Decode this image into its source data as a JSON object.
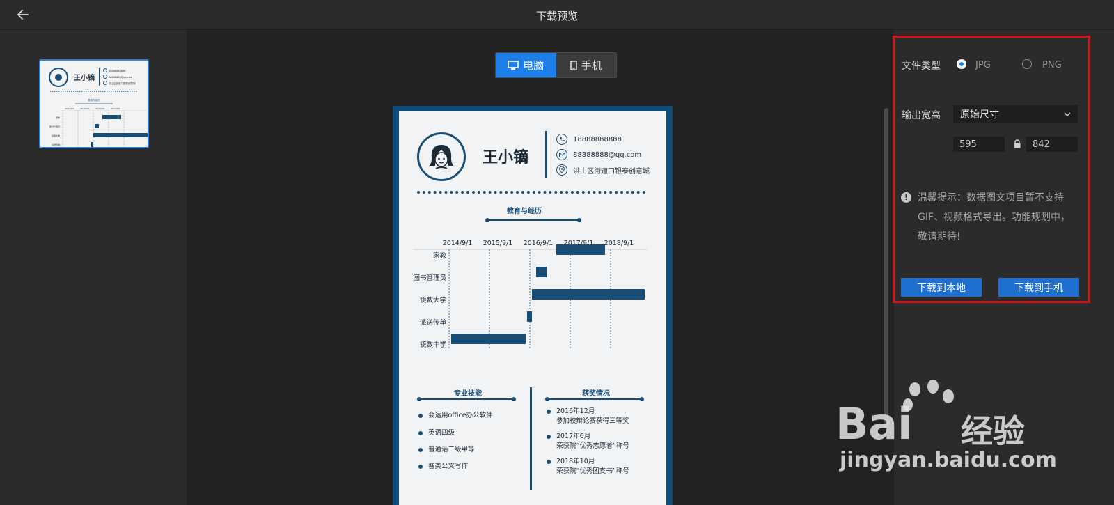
{
  "topbar": {
    "title": "下载预览"
  },
  "device_toggle": {
    "computer": "电脑",
    "mobile": "手机"
  },
  "resume": {
    "name": "王小镝",
    "phone": "18888888888",
    "email": "88888888@qq.com",
    "address": "洪山区街道口银泰创意城",
    "education_title": "教育与经历",
    "dates": [
      "2014/9/1",
      "2015/9/1",
      "2016/9/1",
      "2017/9/1",
      "2018/9/1"
    ],
    "rows": [
      "家教",
      "图书管理员",
      "镜数大学",
      "派送传单",
      "镜数中学"
    ],
    "skills_title": "专业技能",
    "skills": [
      "会运用office办公软件",
      "英语四级",
      "普通话二级甲等",
      "各类公文写作"
    ],
    "awards_title": "获奖情况",
    "awards": [
      {
        "date": "2016年12月",
        "desc": "参加校辩论赛获得三等奖"
      },
      {
        "date": "2017年6月",
        "desc": "荣获院“优秀志愿者”称号"
      },
      {
        "date": "2018年10月",
        "desc": "荣获院“优秀团支书”称号"
      }
    ]
  },
  "thumb": {
    "name": "王小镝",
    "line1": "18888888888",
    "line2": "88888888@qq.com",
    "line3": "洪山区街道口银泰创意城",
    "title": "教育与经历",
    "dates": [
      "2014/9/1",
      "2015/9/1",
      "2016/9/1",
      "2017/9/1"
    ],
    "rows": [
      "家教",
      "图书管理员",
      "镜数大学",
      "派送传单"
    ]
  },
  "settings": {
    "file_type_label": "文件类型",
    "jpg": "JPG",
    "png": "PNG",
    "selected_type": "JPG",
    "output_label": "输出宽高",
    "size_option": "原始尺寸",
    "width": "595",
    "height": "842",
    "tip": "温馨提示：数据图文项目暂不支持GIF、视频格式导出。功能规划中，敬请期待!",
    "download_local": "下载到本地",
    "download_mobile": "下载到手机"
  },
  "watermark": {
    "brand_left": "Bai",
    "brand_right": "经验",
    "url": "jingyan.baidu.com"
  },
  "colors": {
    "accent": "#1e7fe8",
    "resume_blue": "#184e76",
    "highlight_border": "#d3141b"
  }
}
